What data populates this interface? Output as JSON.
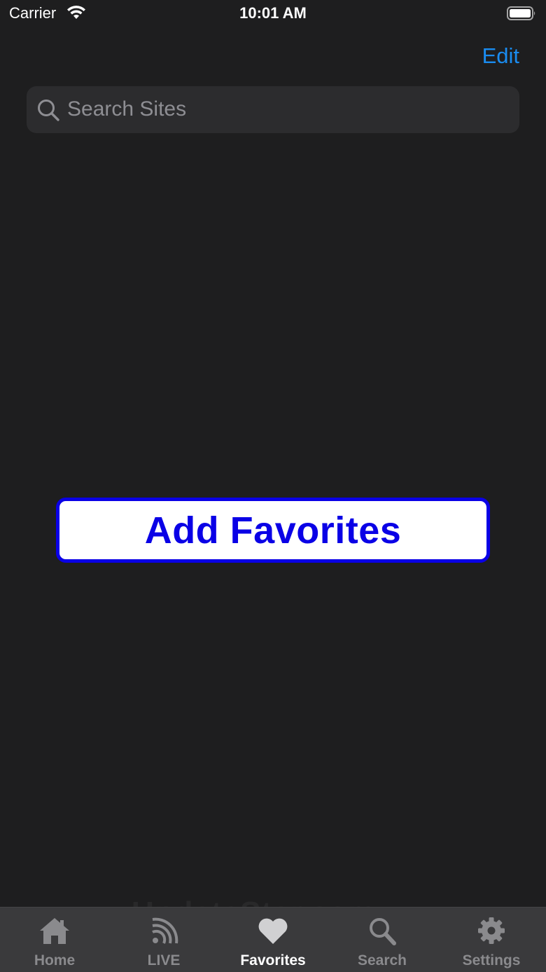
{
  "status_bar": {
    "carrier": "Carrier",
    "time": "10:01 AM",
    "icons": [
      "wifi-icon",
      "battery-icon"
    ]
  },
  "nav": {
    "edit_label": "Edit"
  },
  "search": {
    "placeholder": "Search Sites",
    "icon": "search-icon"
  },
  "main": {
    "add_favorites_label": "Add Favorites"
  },
  "tab_bar": {
    "tabs": [
      {
        "label": "Home",
        "icon": "home-icon",
        "active": false
      },
      {
        "label": "LIVE",
        "icon": "live-feed-icon",
        "active": false
      },
      {
        "label": "Favorites",
        "icon": "heart-icon",
        "active": true
      },
      {
        "label": "Search",
        "icon": "search-icon",
        "active": false
      },
      {
        "label": "Settings",
        "icon": "gear-icon",
        "active": false
      }
    ]
  },
  "watermark": "UpdateStar.com",
  "colors": {
    "background": "#1e1e1f",
    "accent": "#1a8cf0",
    "button_blue": "#0a00e6",
    "tab_bar": "#3a3a3c"
  }
}
